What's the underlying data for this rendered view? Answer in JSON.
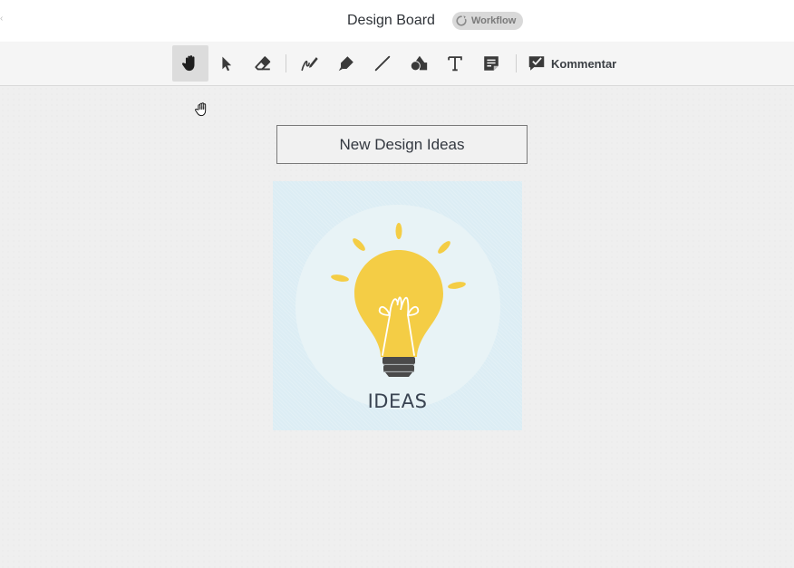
{
  "window": {
    "title": "Design Board",
    "workflow_badge": "Workflow"
  },
  "toolbar": {
    "tools": [
      {
        "name": "hand",
        "icon": "hand-icon",
        "active": true
      },
      {
        "name": "select",
        "icon": "pointer-icon",
        "active": false
      },
      {
        "name": "eraser",
        "icon": "eraser-icon",
        "active": false
      },
      {
        "name": "pen",
        "icon": "pen-icon",
        "active": false
      },
      {
        "name": "highlighter",
        "icon": "highlighter-icon",
        "active": false
      },
      {
        "name": "line",
        "icon": "line-icon",
        "active": false
      },
      {
        "name": "shapes",
        "icon": "shapes-icon",
        "active": false
      },
      {
        "name": "text",
        "icon": "text-icon",
        "active": false
      },
      {
        "name": "sticky-note",
        "icon": "sticky-note-icon",
        "active": false
      }
    ],
    "comment_label": "Kommentar"
  },
  "canvas": {
    "heading_text": "New Design Ideas",
    "image_caption": "IDEAS"
  },
  "colors": {
    "bulb_yellow": "#f4cd45",
    "bulb_base": "#4a4a4a",
    "card_background": "#dcedf4",
    "active_tool_bg": "#dcdcdc"
  }
}
